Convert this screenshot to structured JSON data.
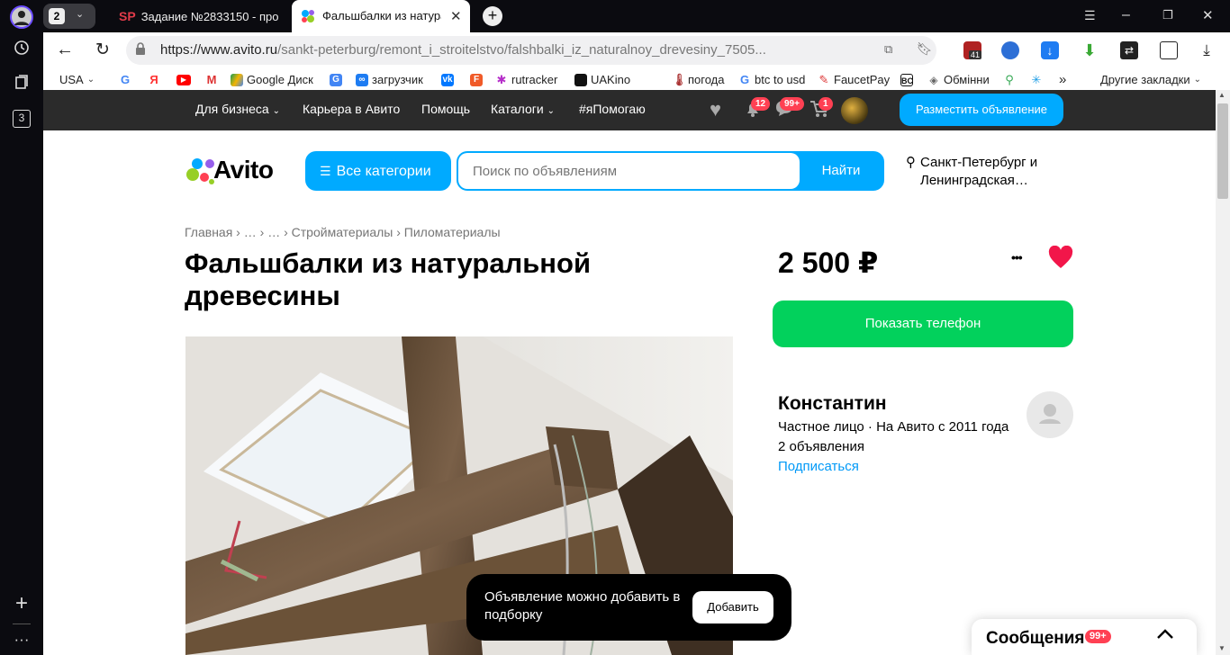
{
  "browser": {
    "tab_count": "2",
    "vertical_tabs_count": "3",
    "tabs": [
      {
        "label": "Задание №2833150 - про",
        "icon": "SP"
      },
      {
        "label": "Фальшбалки из натура",
        "icon": "avito-icon"
      }
    ],
    "url": {
      "host": "https://www.avito.ru",
      "path": "/sankt-peterburg/remont_i_stroitelstvo/falshbalki_iz_naturalnoy_drevesiny_7505..."
    },
    "ext_badge": "41",
    "bookmarks": [
      "USA",
      "Google Диск",
      "загрузчик",
      "rutracker",
      "UAKino",
      "погода",
      "btc to usd",
      "FaucetPay",
      "Обмінни"
    ],
    "bookmarks_more": "»",
    "other_bookmarks": "Другие закладки"
  },
  "site": {
    "nav": [
      "Для бизнеса",
      "Карьера в Авито",
      "Помощь",
      "Каталоги",
      "#яПомогаю"
    ],
    "badges": {
      "notifications": "12",
      "messages": "99+",
      "cart": "1"
    },
    "post_button": "Разместить объявление",
    "logo": "Avito",
    "categories_button": "Все категории",
    "search_placeholder": "Поиск по объявлениям",
    "search_button": "Найти",
    "location": "Санкт-Петербург и Ленинградская…"
  },
  "listing": {
    "breadcrumbs": [
      "Главная",
      "…",
      "…",
      "Стройматериалы",
      "Пиломатериалы"
    ],
    "title": "Фальшбалки из натуральной древесины",
    "price": "2 500 ₽",
    "more": "•••",
    "show_phone": "Показать телефон",
    "seller": {
      "name": "Константин",
      "type": "Частное лицо · На Авито с 2011 года",
      "count": "2 объявления",
      "subscribe": "Подписаться"
    }
  },
  "toast": {
    "text": "Объявление можно добавить в подборку",
    "button": "Добавить"
  },
  "messages_panel": {
    "label": "Сообщения",
    "badge": "99+"
  },
  "colors": {
    "avito_blue": "#00aaff",
    "green": "#02d15c",
    "fav_red": "#f2164a",
    "dark_bar": "#2b2b2b"
  }
}
